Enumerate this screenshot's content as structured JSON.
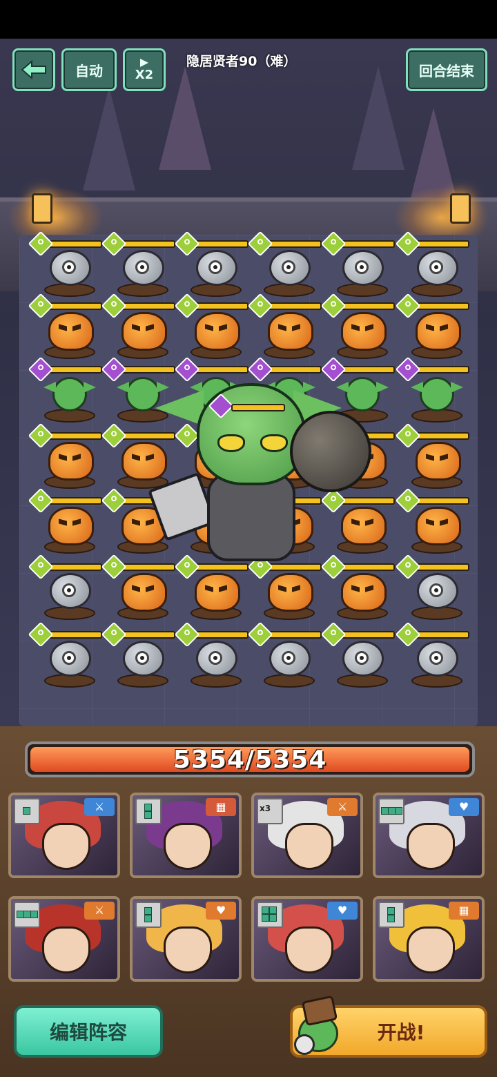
{
  "top_bar": {
    "back_icon": "back-arrow-icon",
    "auto_label": "自动",
    "speed_label": "X2",
    "speed_icon": "play-icon",
    "stage_title": "隐居贤者90（难）",
    "end_turn_label": "回合结束"
  },
  "board": {
    "rows": [
      [
        "eye-orb",
        "eye-orb",
        "eye-orb",
        "eye-orb",
        "eye-orb",
        "eye-orb"
      ],
      [
        "pumpkin",
        "pumpkin",
        "pumpkin",
        "pumpkin",
        "pumpkin",
        "pumpkin"
      ],
      [
        "goblin",
        "goblin",
        "goblin",
        "goblin",
        "goblin",
        "goblin"
      ],
      [
        "pumpkin",
        "pumpkin",
        "pumpkin",
        "pumpkin",
        "pumpkin",
        "pumpkin"
      ],
      [
        "pumpkin",
        "pumpkin",
        "pumpkin",
        "pumpkin",
        "pumpkin",
        "pumpkin"
      ],
      [
        "eye-orb",
        "pumpkin",
        "pumpkin",
        "pumpkin",
        "pumpkin",
        "eye-orb"
      ],
      [
        "eye-orb",
        "eye-orb",
        "eye-orb",
        "eye-orb",
        "eye-orb",
        "eye-orb"
      ]
    ],
    "boss": "goblin-bomber-boss",
    "element_colors": {
      "plant": "#9ccf3a",
      "dark": "#a44ed0"
    }
  },
  "player_hp": {
    "text": "5354/5354",
    "current": 5354,
    "max": 5354
  },
  "heroes": [
    {
      "name_icon": "red-hair-knight-portrait",
      "shape_cells": 1,
      "role_icon": "sword-icon",
      "role_color": "#3f86d6",
      "hair": "#c9473e"
    },
    {
      "name_icon": "dark-wizard-portrait",
      "shape_cells": 2,
      "role_icon": "wall-icon",
      "role_color": "#d45a3a",
      "hair": "#7a3a8e"
    },
    {
      "name_icon": "white-hair-swordsman-portrait",
      "shape_cells": 1,
      "shape_text": "x3",
      "role_icon": "sword-icon",
      "role_color": "#e07a2e",
      "hair": "#e4e4e4"
    },
    {
      "name_icon": "silver-hair-healer-portrait",
      "shape_cells": 3,
      "role_icon": "heart-icon",
      "role_color": "#3f86d6",
      "hair": "#d8d8e0"
    },
    {
      "name_icon": "fox-warrior-portrait",
      "shape_cells": 3,
      "role_icon": "sword-icon",
      "role_color": "#e07a2e",
      "hair": "#b8342a"
    },
    {
      "name_icon": "blonde-hero-portrait",
      "shape_cells": 2,
      "role_icon": "heart-icon",
      "role_color": "#e07a2e",
      "hair": "#f0b64a"
    },
    {
      "name_icon": "red-cap-girl-portrait",
      "shape_cells": 4,
      "role_icon": "heart-icon",
      "role_color": "#3f86d6",
      "hair": "#d4504a"
    },
    {
      "name_icon": "masked-rogue-portrait",
      "shape_cells": 2,
      "role_icon": "wall-icon",
      "role_color": "#e07a2e",
      "hair": "#f0c03a"
    }
  ],
  "bottom_buttons": {
    "edit_team_label": "编辑阵容",
    "start_battle_label": "开战!"
  }
}
